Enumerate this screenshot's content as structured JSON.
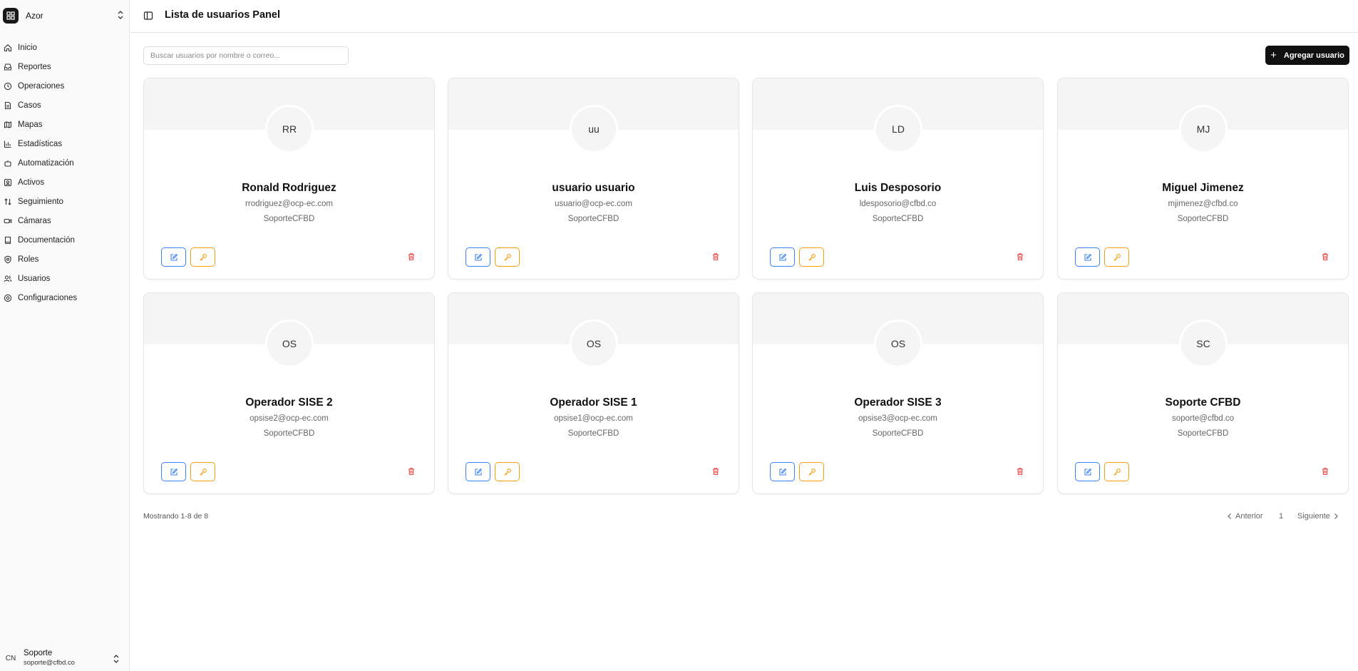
{
  "app": {
    "name": "Azor",
    "colors": {
      "accent": "#111111",
      "edit": "#3b82f6",
      "key": "#f59e0b",
      "delete": "#ef4444"
    }
  },
  "sidebar": {
    "items": [
      {
        "label": "Inicio",
        "icon": "home-icon"
      },
      {
        "label": "Reportes",
        "icon": "inbox-icon"
      },
      {
        "label": "Operaciones",
        "icon": "clock-icon"
      },
      {
        "label": "Casos",
        "icon": "file-icon"
      },
      {
        "label": "Mapas",
        "icon": "map-icon"
      },
      {
        "label": "Estadísticas",
        "icon": "bar-chart-icon"
      },
      {
        "label": "Automatización",
        "icon": "bot-icon"
      },
      {
        "label": "Activos",
        "icon": "asset-icon"
      },
      {
        "label": "Seguimiento",
        "icon": "sort-icon"
      },
      {
        "label": "Cámaras",
        "icon": "camera-icon"
      },
      {
        "label": "Documentación",
        "icon": "book-icon"
      },
      {
        "label": "Roles",
        "icon": "shield-icon"
      },
      {
        "label": "Usuarios",
        "icon": "users-icon"
      },
      {
        "label": "Configuraciones",
        "icon": "gear-icon"
      }
    ],
    "user": {
      "initials": "CN",
      "name": "Soporte",
      "email": "soporte@cfbd.co"
    }
  },
  "header": {
    "title": "Lista de usuarios Panel"
  },
  "toolbar": {
    "search_placeholder": "Buscar usuarios por nombre o correo...",
    "search_value": "",
    "add_label": "Agregar usuario"
  },
  "users": [
    {
      "initials": "RR",
      "name": "Ronald Rodriguez",
      "email": "rrodriguez@ocp-ec.com",
      "company": "SoporteCFBD"
    },
    {
      "initials": "uu",
      "name": "usuario usuario",
      "email": "usuario@ocp-ec.com",
      "company": "SoporteCFBD"
    },
    {
      "initials": "LD",
      "name": "Luis Desposorio",
      "email": "ldesposorio@cfbd.co",
      "company": "SoporteCFBD"
    },
    {
      "initials": "MJ",
      "name": "Miguel Jimenez",
      "email": "mjimenez@cfbd.co",
      "company": "SoporteCFBD"
    },
    {
      "initials": "OS",
      "name": "Operador SISE 2",
      "email": "opsise2@ocp-ec.com",
      "company": "SoporteCFBD"
    },
    {
      "initials": "OS",
      "name": "Operador SISE 1",
      "email": "opsise1@ocp-ec.com",
      "company": "SoporteCFBD"
    },
    {
      "initials": "OS",
      "name": "Operador SISE 3",
      "email": "opsise3@ocp-ec.com",
      "company": "SoporteCFBD"
    },
    {
      "initials": "SC",
      "name": "Soporte CFBD",
      "email": "soporte@cfbd.co",
      "company": "SoporteCFBD"
    }
  ],
  "pagination": {
    "summary": "Mostrando 1-8 de 8",
    "prev_label": "Anterior",
    "page": "1",
    "next_label": "Siguiente"
  }
}
